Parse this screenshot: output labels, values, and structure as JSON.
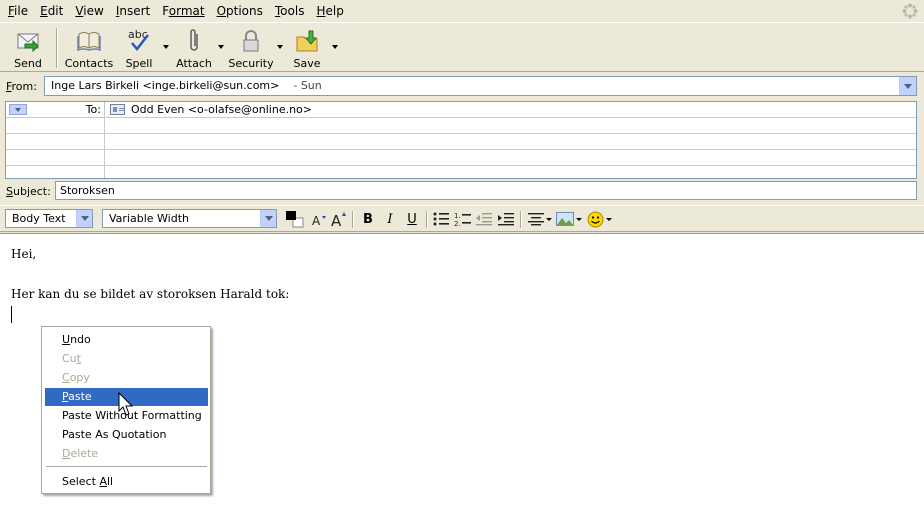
{
  "menubar": {
    "items": [
      {
        "key": "F",
        "rest": "ile"
      },
      {
        "key": "E",
        "rest": "dit"
      },
      {
        "key": "V",
        "rest": "iew"
      },
      {
        "key": "I",
        "rest": "nsert"
      },
      {
        "key": "F",
        "rest": "ormat"
      },
      {
        "key": "O",
        "rest": "ptions"
      },
      {
        "key": "T",
        "rest": "ools"
      },
      {
        "key": "H",
        "rest": "elp"
      }
    ]
  },
  "toolbar": {
    "send": "Send",
    "contacts": "Contacts",
    "spell": "Spell",
    "attach": "Attach",
    "security": "Security",
    "save": "Save",
    "spell_glyph": "abc"
  },
  "header": {
    "from_label": "From:",
    "from_value": "Inge Lars Birkeli <inge.birkeli@sun.com>",
    "from_account": "- Sun",
    "to_label": "To:",
    "to_value": "Odd Even <o-olafse@online.no>",
    "subject_label": "Subject:",
    "subject_value": "Storoksen"
  },
  "format": {
    "paragraph_style": "Body Text",
    "font": "Variable Width",
    "text_color": "#000000",
    "bold": "B",
    "italic": "I",
    "underline": "U"
  },
  "body": {
    "line1": "Hei,",
    "line2": "Her kan du se bildet av storoksen Harald tok:"
  },
  "context_menu": {
    "undo": "Undo",
    "cut": "Cut",
    "copy": "Copy",
    "paste": "Paste",
    "paste_without_formatting": "Paste Without Formatting",
    "paste_as_quotation": "Paste As Quotation",
    "delete": "Delete",
    "select_all": "Select All"
  },
  "colors": {
    "chrome": "#ece9d8",
    "highlight": "#316ac5",
    "field_border": "#7f9db9"
  }
}
